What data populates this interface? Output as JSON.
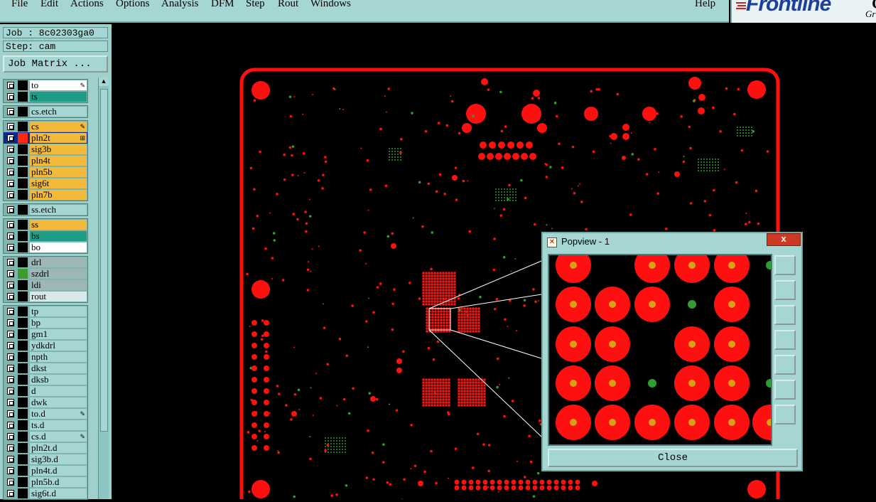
{
  "menu": [
    {
      "label": "File"
    },
    {
      "label": "Edit"
    },
    {
      "label": "Actions"
    },
    {
      "label": "Options"
    },
    {
      "label": "Analysis"
    },
    {
      "label": "DFM"
    },
    {
      "label": "Step"
    },
    {
      "label": "Rout"
    },
    {
      "label": "Windows"
    }
  ],
  "help_label": "Help",
  "logo": {
    "brand": "Frontline",
    "extra": "Ge",
    "sub": "Gr"
  },
  "job": {
    "job_line": "Job : 8c02303ga0",
    "step_line": "Step: cam",
    "matrix_button": "Job Matrix ..."
  },
  "layers": [
    [
      {
        "name": "to",
        "color": "#ffffff",
        "mark": "✎"
      },
      {
        "name": "ts",
        "color": "#1f9c86",
        "mark": ""
      }
    ],
    [
      {
        "name": "cs.etch",
        "color": "#a6d6d3",
        "mark": ""
      }
    ],
    [
      {
        "name": "cs",
        "color": "#f2b93b",
        "mark": "✎"
      },
      {
        "name": "pln2t",
        "color": "#f2b93b",
        "mark": "⊞",
        "selected": true,
        "swatch": "#ff2a10"
      },
      {
        "name": "sig3b",
        "color": "#f2b93b"
      },
      {
        "name": "pln4t",
        "color": "#f2b93b"
      },
      {
        "name": "pln5b",
        "color": "#f2b93b"
      },
      {
        "name": "sig6t",
        "color": "#f2b93b"
      },
      {
        "name": "pln7b",
        "color": "#f2b93b"
      }
    ],
    [
      {
        "name": "ss.etch",
        "color": "#a6d6d3"
      }
    ],
    [
      {
        "name": "ss",
        "color": "#f2b93b"
      },
      {
        "name": "bs",
        "color": "#1f9c86"
      },
      {
        "name": "bo",
        "color": "#ffffff"
      }
    ],
    [
      {
        "name": "drl",
        "color": "#9cb7b5"
      },
      {
        "name": "szdrl",
        "color": "#9cb7b5",
        "swatch": "#3c9a2e"
      },
      {
        "name": "ldi",
        "color": "#9cb7b5"
      },
      {
        "name": "rout",
        "color": "#d8e8e8"
      }
    ],
    [
      {
        "name": "tp",
        "color": "#a6d6d3"
      },
      {
        "name": "bp",
        "color": "#a6d6d3"
      },
      {
        "name": "gm1",
        "color": "#a6d6d3"
      },
      {
        "name": "ydkdrl",
        "color": "#a6d6d3"
      },
      {
        "name": "npth",
        "color": "#a6d6d3"
      },
      {
        "name": "dkst",
        "color": "#a6d6d3"
      },
      {
        "name": "dksb",
        "color": "#a6d6d3"
      },
      {
        "name": "d",
        "color": "#a6d6d3"
      },
      {
        "name": "dwk",
        "color": "#a6d6d3"
      },
      {
        "name": "to.d",
        "color": "#a6d6d3",
        "mark": "✎"
      },
      {
        "name": "ts.d",
        "color": "#a6d6d3"
      },
      {
        "name": "cs.d",
        "color": "#a6d6d3",
        "mark": "✎"
      },
      {
        "name": "pln2t.d",
        "color": "#a6d6d3"
      },
      {
        "name": "sig3b.d",
        "color": "#a6d6d3"
      },
      {
        "name": "pln4t.d",
        "color": "#a6d6d3"
      },
      {
        "name": "pln5b.d",
        "color": "#a6d6d3"
      },
      {
        "name": "sig6t.d",
        "color": "#a6d6d3"
      }
    ]
  ],
  "popview": {
    "title": "Popview - 1",
    "close_x": "x",
    "close_button": "Close"
  },
  "colors": {
    "board": "#ff1010",
    "pad_center": "#d8a015",
    "green_via": "#2f9d2f",
    "panel": "#a6d6d3"
  }
}
